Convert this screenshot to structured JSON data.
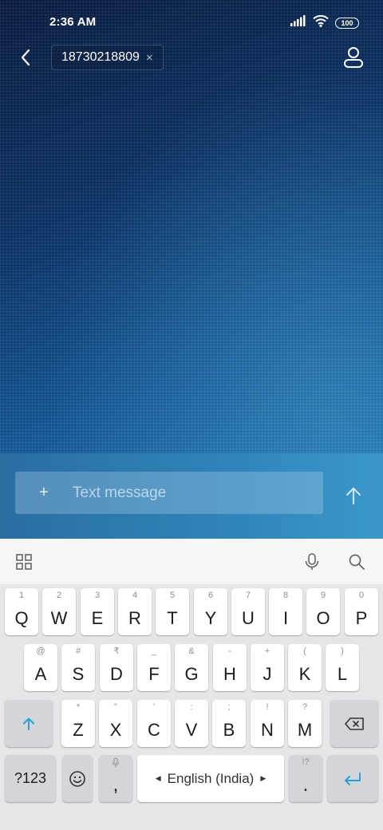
{
  "status_bar": {
    "time": "2:36 AM",
    "battery": "100"
  },
  "header": {
    "recipient": "18730218809",
    "chip_close": "×"
  },
  "composer": {
    "plus": "+",
    "placeholder": "Text message"
  },
  "keyboard": {
    "row1": [
      {
        "hint": "1",
        "key": "Q"
      },
      {
        "hint": "2",
        "key": "W"
      },
      {
        "hint": "3",
        "key": "E"
      },
      {
        "hint": "4",
        "key": "R"
      },
      {
        "hint": "5",
        "key": "T"
      },
      {
        "hint": "6",
        "key": "Y"
      },
      {
        "hint": "7",
        "key": "U"
      },
      {
        "hint": "8",
        "key": "I"
      },
      {
        "hint": "9",
        "key": "O"
      },
      {
        "hint": "0",
        "key": "P"
      }
    ],
    "row2": [
      {
        "hint": "@",
        "key": "A"
      },
      {
        "hint": "#",
        "key": "S"
      },
      {
        "hint": "₹",
        "key": "D"
      },
      {
        "hint": "_",
        "key": "F"
      },
      {
        "hint": "&",
        "key": "G"
      },
      {
        "hint": "-",
        "key": "H"
      },
      {
        "hint": "+",
        "key": "J"
      },
      {
        "hint": "(",
        "key": "K"
      },
      {
        "hint": ")",
        "key": "L"
      }
    ],
    "row3": [
      {
        "hint": "*",
        "key": "Z"
      },
      {
        "hint": "\"",
        "key": "X"
      },
      {
        "hint": "'",
        "key": "C"
      },
      {
        "hint": ":",
        "key": "V"
      },
      {
        "hint": ";",
        "key": "B"
      },
      {
        "hint": "!",
        "key": "N"
      },
      {
        "hint": "?",
        "key": "M"
      }
    ],
    "symbols_label": "?123",
    "comma": ",",
    "space_label": "English (India)",
    "period": ".",
    "period_hint": "!?"
  },
  "colors": {
    "accent": "#2a9fd8",
    "key_text": "#1c1c1c"
  }
}
